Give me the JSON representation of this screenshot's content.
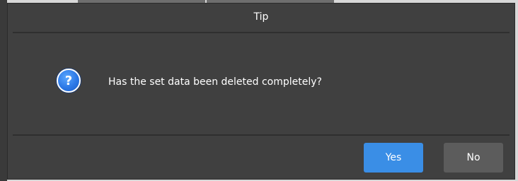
{
  "dialog": {
    "title": "Tip",
    "icon": "question-icon",
    "icon_glyph": "?",
    "message": "Has the set data been deleted completely?",
    "buttons": {
      "yes_label": "Yes",
      "no_label": "No"
    }
  },
  "colors": {
    "dialog_bg": "#404040",
    "accent": "#3a8ee6",
    "secondary_button": "#5c5c5c",
    "text": "#ffffff"
  }
}
